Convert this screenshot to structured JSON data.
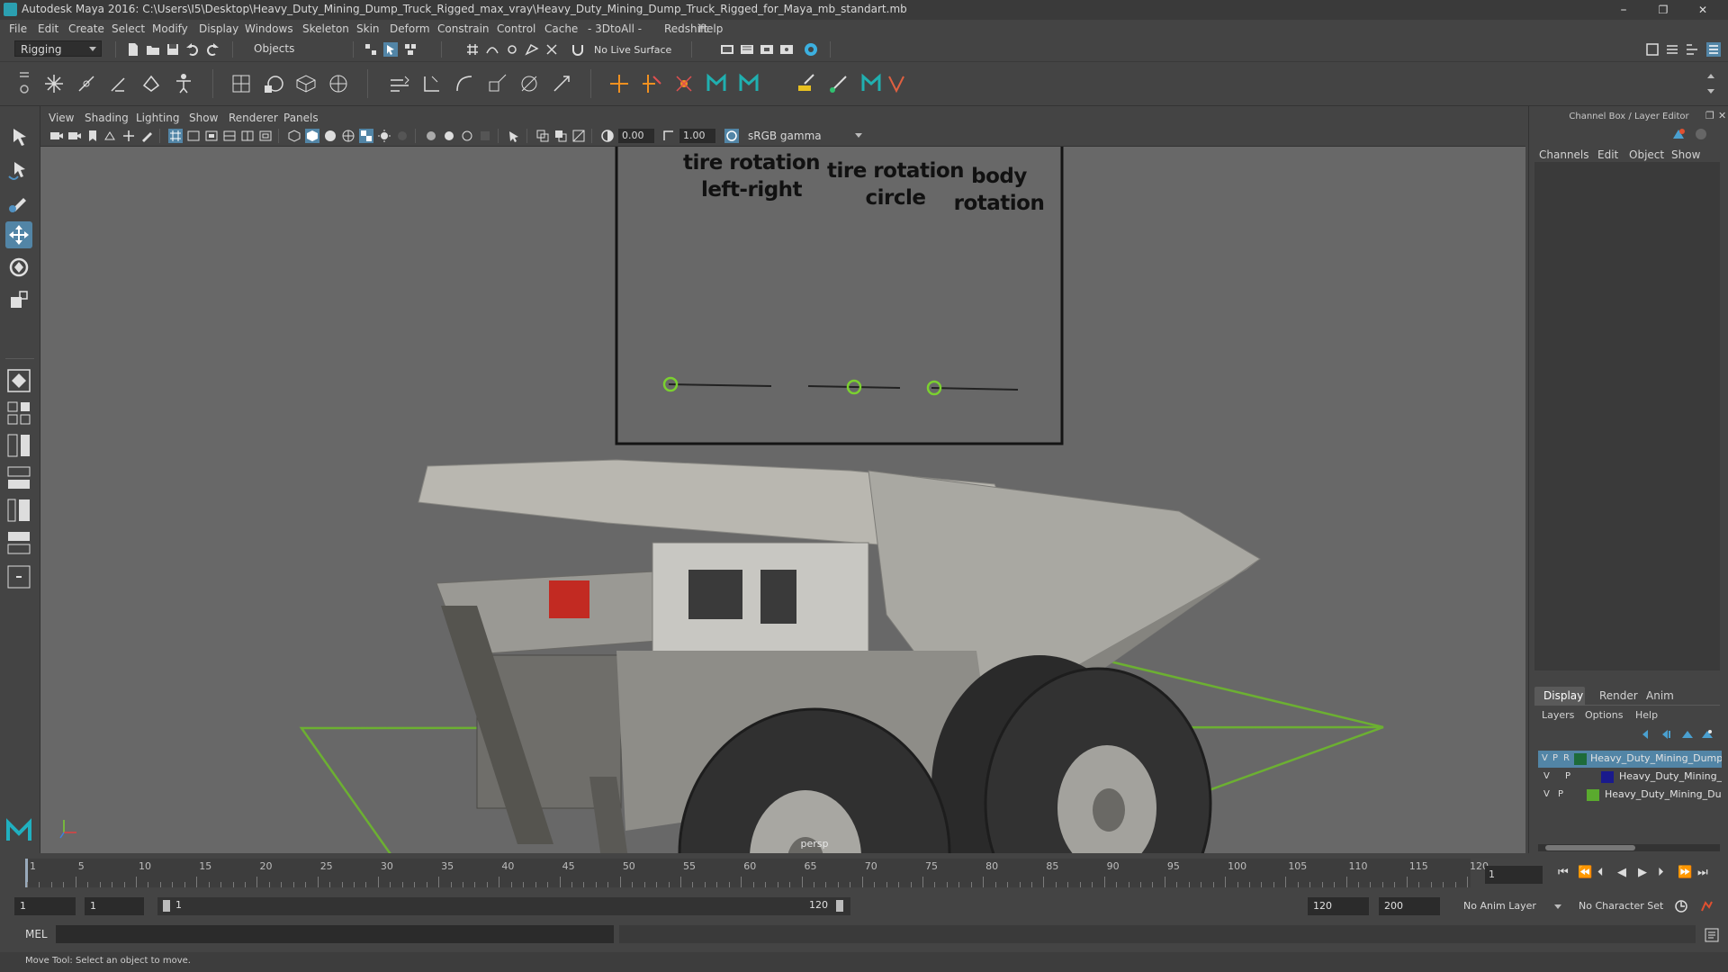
{
  "window": {
    "title": "Autodesk Maya 2016: C:\\Users\\I5\\Desktop\\Heavy_Duty_Mining_Dump_Truck_Rigged_max_vray\\Heavy_Duty_Mining_Dump_Truck_Rigged_for_Maya_mb_standart.mb",
    "minimize": "–",
    "maximize": "❐",
    "close": "✕"
  },
  "menubar": [
    "File",
    "Edit",
    "Create",
    "Select",
    "Modify",
    "Display",
    "Windows",
    "Skeleton",
    "Skin",
    "Deform",
    "Constrain",
    "Control",
    "Cache",
    "- 3DtoAll -",
    "Redshift",
    "Help"
  ],
  "statusline": {
    "menuset": "Rigging",
    "selection_mode": "Objects",
    "live_surface": "No Live Surface"
  },
  "viewport": {
    "menu": [
      "View",
      "Shading",
      "Lighting",
      "Show",
      "Renderer",
      "Panels"
    ],
    "exposure": "0.00",
    "gamma": "1.00",
    "colorspace": "sRGB gamma",
    "camera_label": "persp",
    "rig_labels": {
      "tire_lr": [
        "tire rotation",
        "left-right"
      ],
      "tire_circle": [
        "tire rotation",
        "circle"
      ],
      "body": [
        "body",
        "rotation"
      ]
    }
  },
  "channel_box": {
    "title": "Channel Box / Layer Editor",
    "menu": [
      "Channels",
      "Edit",
      "Object",
      "Show"
    ]
  },
  "layer_editor": {
    "tabs": [
      "Display",
      "Render",
      "Anim"
    ],
    "active_tab": "Display",
    "menu": [
      "Layers",
      "Options",
      "Help"
    ],
    "layers": [
      {
        "v": "V",
        "p": "P",
        "r": "R",
        "color": "#1e6b3a",
        "name": "Heavy_Duty_Mining_Dump_T",
        "selected": true
      },
      {
        "v": "V",
        "p": "P",
        "r": "",
        "color": "#1a1a8c",
        "name": "Heavy_Duty_Mining_D",
        "selected": false
      },
      {
        "v": "V",
        "p": "P",
        "r": "",
        "color": "#5aaa2e",
        "name": "Heavy_Duty_Mining_Dum",
        "selected": false
      }
    ]
  },
  "timeline": {
    "ticks": [
      "1",
      "5",
      "10",
      "15",
      "20",
      "25",
      "30",
      "35",
      "40",
      "45",
      "50",
      "55",
      "60",
      "65",
      "70",
      "75",
      "80",
      "85",
      "90",
      "95",
      "100",
      "105",
      "110",
      "115",
      "120"
    ],
    "current_frame": "1"
  },
  "range": {
    "start": "1",
    "playback_start": "1",
    "slider_start": "1",
    "slider_end": "120",
    "playback_end": "120",
    "end": "200",
    "anim_layer": "No Anim Layer",
    "character_set": "No Character Set"
  },
  "command": {
    "lang": "MEL"
  },
  "help": {
    "text": "Move Tool: Select an object to move."
  }
}
